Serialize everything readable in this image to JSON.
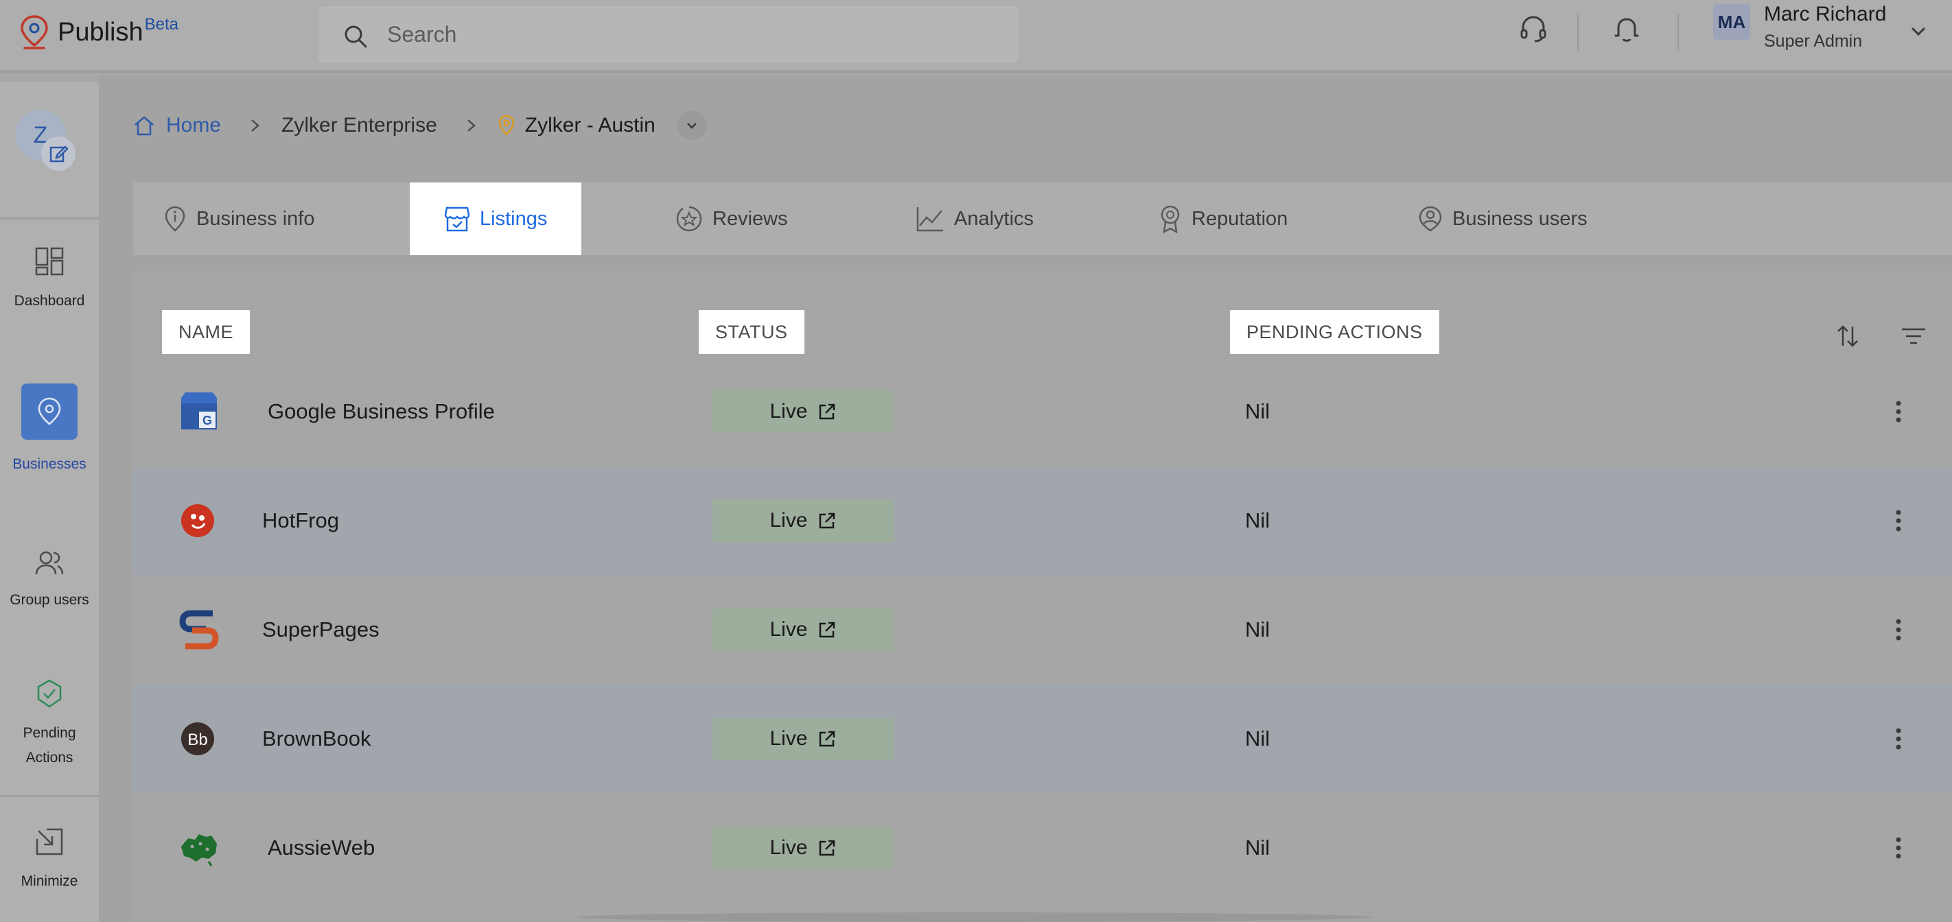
{
  "app": {
    "name": "Publish",
    "badge": "Beta"
  },
  "search": {
    "placeholder": "Search"
  },
  "user": {
    "initials": "MA",
    "name": "Marc Richard",
    "role": "Super Admin"
  },
  "sidebar": {
    "avatar_letter": "Z",
    "items": [
      {
        "label": "Dashboard"
      },
      {
        "label": "Businesses"
      },
      {
        "label": "Group users"
      },
      {
        "label": "Pending Actions"
      },
      {
        "label": "Minimize"
      }
    ]
  },
  "breadcrumb": {
    "home": "Home",
    "org": "Zylker Enterprise",
    "location": "Zylker - Austin"
  },
  "tabs": [
    {
      "label": "Business info"
    },
    {
      "label": "Listings"
    },
    {
      "label": "Reviews"
    },
    {
      "label": "Analytics"
    },
    {
      "label": "Reputation"
    },
    {
      "label": "Business users"
    }
  ],
  "table": {
    "columns": [
      "NAME",
      "STATUS",
      "PENDING ACTIONS"
    ],
    "rows": [
      {
        "name": "Google Business Profile",
        "status": "Live",
        "pending": "Nil"
      },
      {
        "name": "HotFrog",
        "status": "Live",
        "pending": "Nil"
      },
      {
        "name": "SuperPages",
        "status": "Live",
        "pending": "Nil"
      },
      {
        "name": "BrownBook",
        "status": "Live",
        "pending": "Nil"
      },
      {
        "name": "AussieWeb",
        "status": "Live",
        "pending": "Nil"
      }
    ]
  },
  "colors": {
    "accent": "#1f6ae3",
    "status_bg": "#9dae9d",
    "active_nav": "#4a77c4"
  }
}
